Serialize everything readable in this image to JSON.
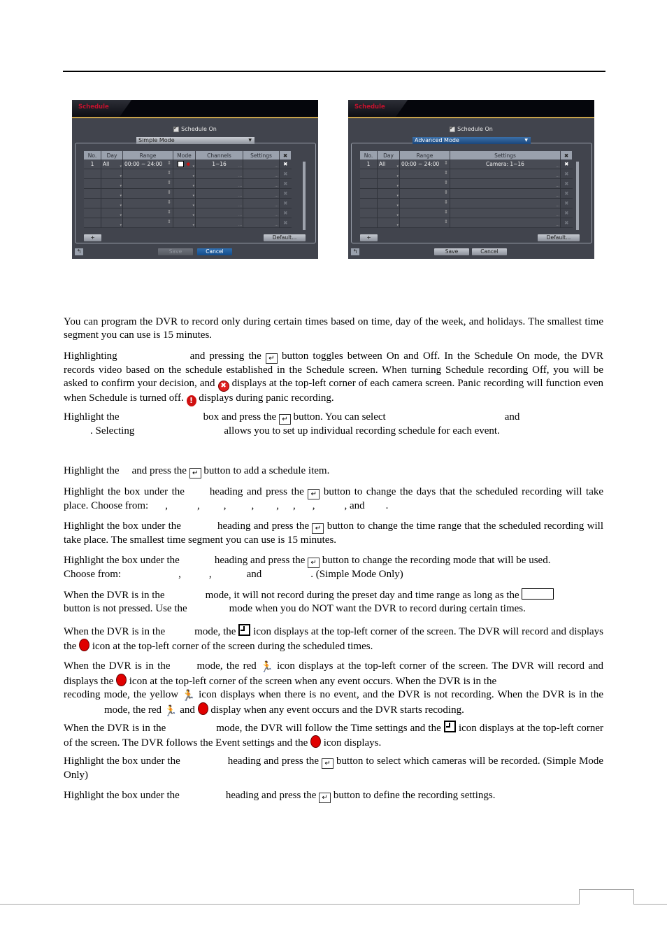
{
  "screens": {
    "simple": {
      "title": "Schedule",
      "schedule_on_label": "Schedule On",
      "schedule_on_checked": true,
      "mode_select": "Simple Mode",
      "columns": [
        "No.",
        "Day",
        "Range",
        "Mode",
        "Channels",
        "Settings",
        "✖"
      ],
      "rows": [
        {
          "no": "1",
          "day": "All",
          "range": "00:00 ~ 24:00",
          "mode": "time+event",
          "channels": "1~16",
          "settings": ""
        },
        {
          "no": "",
          "day": "",
          "range": "",
          "mode": "",
          "channels": "",
          "settings": ""
        },
        {
          "no": "",
          "day": "",
          "range": "",
          "mode": "",
          "channels": "",
          "settings": ""
        },
        {
          "no": "",
          "day": "",
          "range": "",
          "mode": "",
          "channels": "",
          "settings": ""
        },
        {
          "no": "",
          "day": "",
          "range": "",
          "mode": "",
          "channels": "",
          "settings": ""
        },
        {
          "no": "",
          "day": "",
          "range": "",
          "mode": "",
          "channels": "",
          "settings": ""
        },
        {
          "no": "",
          "day": "",
          "range": "",
          "mode": "",
          "channels": "",
          "settings": ""
        }
      ],
      "add_label": "+",
      "default_label": "Default...",
      "save_label": "Save",
      "cancel_label": "Cancel",
      "save_enabled": false
    },
    "advanced": {
      "title": "Schedule",
      "schedule_on_label": "Schedule On",
      "schedule_on_checked": true,
      "mode_select": "Advanced Mode",
      "columns": [
        "No.",
        "Day",
        "Range",
        "Settings",
        "✖"
      ],
      "rows": [
        {
          "no": "1",
          "day": "All",
          "range": "00:00 ~ 24:00",
          "settings": "Camera: 1~16"
        },
        {
          "no": "",
          "day": "",
          "range": "",
          "settings": ""
        },
        {
          "no": "",
          "day": "",
          "range": "",
          "settings": ""
        },
        {
          "no": "",
          "day": "",
          "range": "",
          "settings": ""
        },
        {
          "no": "",
          "day": "",
          "range": "",
          "settings": ""
        },
        {
          "no": "",
          "day": "",
          "range": "",
          "settings": ""
        },
        {
          "no": "",
          "day": "",
          "range": "",
          "settings": ""
        }
      ],
      "add_label": "+",
      "default_label": "Default...",
      "save_label": "Save",
      "cancel_label": "Cancel",
      "save_enabled": true
    }
  },
  "text": {
    "p1": "You can program the DVR to record only during certain times based on time, day of the week, and holidays.  The smallest time segment you can use is 15 minutes.",
    "p2a": "Highlighting",
    "p2b": "and pressing the",
    "p2c": "button toggles between On and Off.  In the Schedule On mode, the DVR records video based on the schedule established in the Schedule screen.  When turning Schedule recording Off, you will be asked to confirm your decision, and",
    "p2d": "displays at the top-left corner of each camera screen.  Panic recording will function even when Schedule is turned off.",
    "p2e": "displays during panic recording.",
    "p3a": "Highlight the",
    "p3b": "box and press the",
    "p3c": "button.  You can select",
    "p3d": "and",
    "p3e": ".  Selecting",
    "p3f": "allows you to set up individual recording schedule for each event.",
    "p4a": "Highlight the",
    "p4b": "and press the",
    "p4c": "button to add a schedule item.",
    "p5a": "Highlight the box under the",
    "p5b": "heading and press the",
    "p5c": "button to change the days that the scheduled recording will take place.  Choose from:",
    "p5d": ",",
    "p5e": "and",
    "p5f": ".",
    "p6a": "Highlight the box under the",
    "p6b": "heading and press the",
    "p6c": "button to change the time range that the scheduled recording will take place.  The smallest time segment you can use is 15 minutes.",
    "p7a": "Highlight the box under the",
    "p7b": "heading and press the",
    "p7c": "button to change the recording mode that will be used.",
    "p7d": "Choose from:",
    "p7e": ",",
    "p7f": "and",
    "p7g": ". (Simple Mode Only)",
    "p8a": "When the DVR is in the",
    "p8b": "mode, it will not record during the preset day and time range as long as the",
    "p8c": "button is not pressed.  Use the",
    "p8d": "mode when you do NOT want the DVR to record during certain times.",
    "p9a": "When the DVR is in the",
    "p9b": "mode, the",
    "p9c": "icon displays at the top-left corner of the screen.  The DVR will record and displays the",
    "p9d": "icon at the top-left corner of the screen during the scheduled times.",
    "p10a": "When the DVR is in the",
    "p10b": "mode, the red",
    "p10c": "icon displays at the top-left corner of the screen.  The DVR will record and displays the",
    "p10d": "icon at the top-left corner of the screen when any event occurs.  When the DVR is in the",
    "p10e": "recoding mode, the yellow",
    "p10f": "icon displays when there is no event, and the DVR is not recording.  When the DVR is in the",
    "p10g": "mode, the red",
    "p10h": "and",
    "p10i": "display when any event occurs and the DVR starts recoding.",
    "p11a": "When the DVR is in the",
    "p11b": "mode, the DVR will follow the Time settings and the",
    "p11c": "icon displays at the top-left corner of the screen.  The DVR follows the Event settings and the",
    "p11d": "icon displays.",
    "p12a": "Highlight the box under the",
    "p12b": "heading and press the",
    "p12c": "button to select which cameras will be recorded. (Simple Mode Only)",
    "p13a": "Highlight the box under the",
    "p13b": "heading and press the",
    "p13c": "button to define the recording settings."
  },
  "icons": {
    "enter": "↵",
    "schedule_off": "✖",
    "panic": "!",
    "run": "🏃"
  }
}
